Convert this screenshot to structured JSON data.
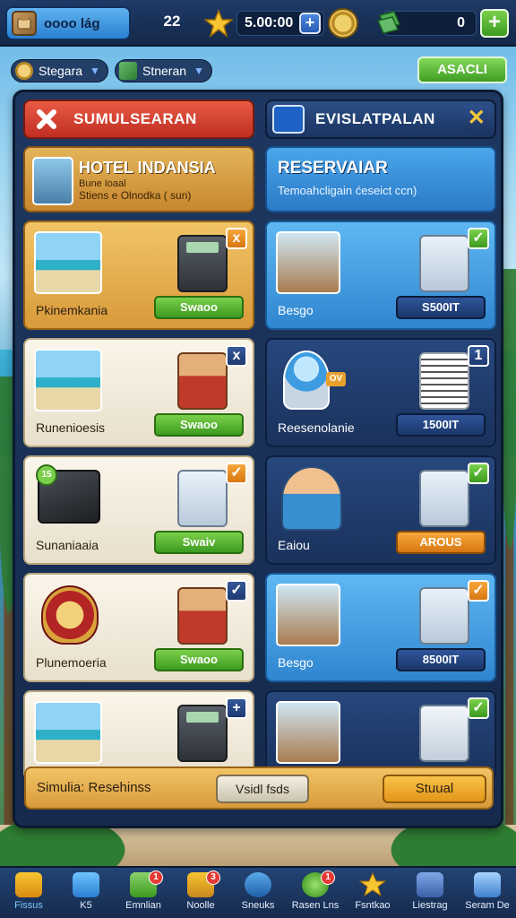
{
  "topbar": {
    "player_name": "oooo lág",
    "level": "22",
    "coins": "5.00:00",
    "gems": "0"
  },
  "pills": [
    {
      "label": "Stegara",
      "icon": "coin-icon"
    },
    {
      "label": "Stneran",
      "icon": "cash-icon"
    }
  ],
  "top_right_button": "ASACLI",
  "left_column": {
    "header": "SUMULSEARAN",
    "info": {
      "title": "HOTEL INDANSIA",
      "line1": "Bune Ioaal",
      "line2": "Stiens e Olnodka ( sun)"
    },
    "cards": [
      {
        "label": "Pkinemkania",
        "button": "Swaoo",
        "badge": "x"
      },
      {
        "label": "Runenioesis",
        "button": "Swaoo",
        "badge": "x"
      },
      {
        "label": "Sunaniaaia",
        "button": "Swaiv",
        "badge": "✓"
      },
      {
        "label": "Plunemoeria",
        "button": "Swaoo",
        "badge": "✓"
      },
      {
        "label": "",
        "button": "",
        "badge": "+"
      }
    ],
    "footer": {
      "label": "Simulia: Resehinss",
      "middle_button": "Vsidl fsds",
      "right_button": "Stuual"
    }
  },
  "right_column": {
    "header": "EVISLATPALAN",
    "info": {
      "title": "RESERVAIAR",
      "subtitle": "Temoahcligain ćeseict ccn)"
    },
    "cards": [
      {
        "label": "Besgo",
        "button": "S500IT",
        "badge": "✓"
      },
      {
        "label": "Reesenolanie",
        "button": "1500IT",
        "badge": "1",
        "tag": "OV"
      },
      {
        "label": "Eaiou",
        "button": "AROUS",
        "badge": "✓"
      },
      {
        "label": "Besgo",
        "button": "8500IT",
        "badge": "✓"
      },
      {
        "label": "",
        "button": "",
        "badge": "✓"
      }
    ]
  },
  "bottom_nav": [
    {
      "label": "Fissus",
      "active": true,
      "badge": ""
    },
    {
      "label": "K5",
      "active": false,
      "badge": ""
    },
    {
      "label": "Emnlian",
      "active": false,
      "badge": "1"
    },
    {
      "label": "Noolle",
      "active": false,
      "badge": "3"
    },
    {
      "label": "Sneuks",
      "active": false,
      "badge": ""
    },
    {
      "label": "Rasen Lns",
      "active": false,
      "badge": "1"
    },
    {
      "label": "Fsntkao",
      "active": false,
      "badge": ""
    },
    {
      "label": "Liestrag",
      "active": false,
      "badge": ""
    },
    {
      "label": "Seram De",
      "active": false,
      "badge": ""
    }
  ],
  "colors": {
    "left_header": "#d83d2d",
    "right_header": "#1f3a69",
    "green_button": "#4caf2a",
    "orange_button": "#e88a1c",
    "navy_button": "#23447c"
  }
}
